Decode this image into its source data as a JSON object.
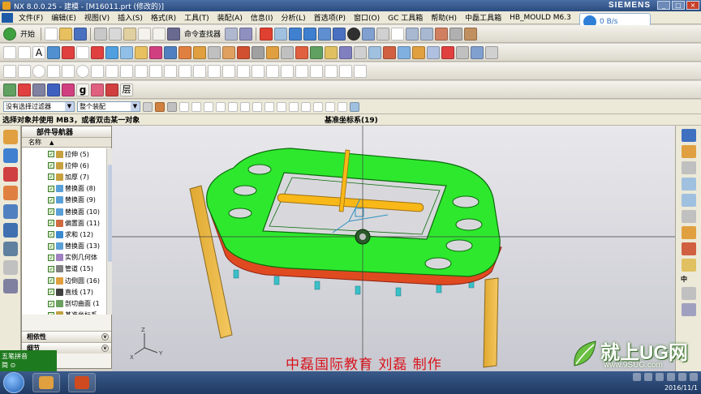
{
  "window": {
    "title": "NX 8.0.0.25 - 建模 - [M16011.prt (修改的)]",
    "brand": "SIEMENS",
    "network_speed": "0 B/s"
  },
  "menu": [
    "文件(F)",
    "编辑(E)",
    "视图(V)",
    "插入(S)",
    "格式(R)",
    "工具(T)",
    "装配(A)",
    "信息(I)",
    "分析(L)",
    "首选项(P)",
    "窗口(O)",
    "GC 工具箱",
    "帮助(H)",
    "中磊工具箱",
    "HB_MOULD M6.3"
  ],
  "toolbar": {
    "start_label": "开始",
    "command_finder": "命令查找器"
  },
  "selection_bar": {
    "filter": "没有选择过滤器",
    "assembly_scope": "整个装配"
  },
  "cue": {
    "prompt": "选择对象并使用 MB3，或者双击某一对象",
    "status": "基准坐标系(19)"
  },
  "navigator": {
    "title": "部件导航器",
    "column_header": "名称",
    "items": [
      {
        "label": "拉伸 (5)",
        "color": "#c8a040"
      },
      {
        "label": "拉伸 (6)",
        "color": "#c8a040"
      },
      {
        "label": "加厚 (7)",
        "color": "#c8a040"
      },
      {
        "label": "替换面 (8)",
        "color": "#5aa0d8"
      },
      {
        "label": "替换面 (9)",
        "color": "#5aa0d8"
      },
      {
        "label": "替换面 (10)",
        "color": "#5aa0d8"
      },
      {
        "label": "偏置面 (11)",
        "color": "#d06a40"
      },
      {
        "label": "求和 (12)",
        "color": "#3a8ad0"
      },
      {
        "label": "替换面 (13)",
        "color": "#5aa0d8"
      },
      {
        "label": "实例几何体",
        "color": "#a080c0"
      },
      {
        "label": "管道 (15)",
        "color": "#808080"
      },
      {
        "label": "边倒圆 (16)",
        "color": "#e0a040"
      },
      {
        "label": "直线 (17)",
        "color": "#404040"
      },
      {
        "label": "剖切曲面 (1",
        "color": "#6aa060"
      },
      {
        "label": "基准坐标系",
        "color": "#c0a040"
      }
    ],
    "sections": [
      "相依性",
      "细节"
    ]
  },
  "ime": {
    "line1": "五笔拼音",
    "line2": "简 ⊙"
  },
  "viewport": {
    "watermark": "中磊国际教育  刘磊  制作",
    "coord_labels": [
      "Z",
      "Y",
      "X"
    ]
  },
  "right_panel": {
    "label": "中"
  },
  "site_logo": {
    "text": "就上UG网",
    "url": "www.9SUG.com"
  },
  "tray": {
    "date": "2016/11/1"
  }
}
